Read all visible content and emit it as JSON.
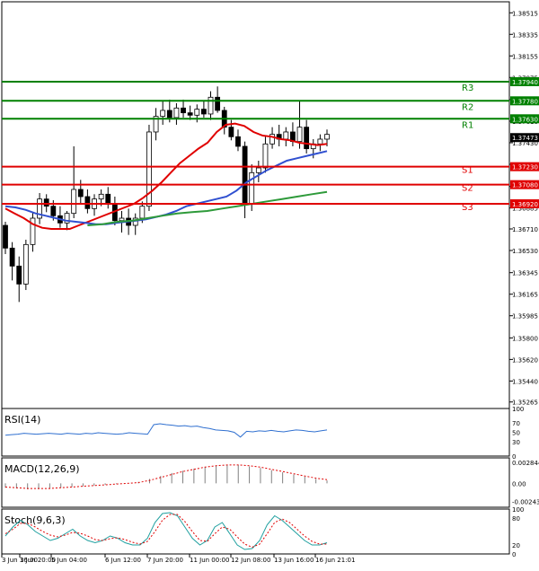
{
  "chart_data": {
    "type": "candlestick",
    "instrument_timeframe": "",
    "x_tick_labels": [
      "3 Jun 16:00",
      "3 Jun 20:00",
      "5 Jun 04:00",
      "6 Jun 12:00",
      "7 Jun 20:00",
      "11 Jun 00:00",
      "12 Jun 08:00",
      "13 Jun 16:00",
      "16 Jun 21:01"
    ],
    "price_axis": {
      "ylim": [
        1.35173,
        1.38607
      ],
      "tick_values": [
        1.38515,
        1.38335,
        1.38155,
        1.37975,
        1.3779,
        1.3761,
        1.3743,
        1.3725,
        1.37065,
        1.36885,
        1.3671,
        1.3653,
        1.36345,
        1.36165,
        1.35985,
        1.358,
        1.3562,
        1.3544,
        1.35265
      ],
      "tick_labels": [
        "1.38515",
        "1.38335",
        "1.38155",
        "1.37975",
        "1.37790",
        "1.37610",
        "1.37430",
        "1.37250",
        "1.37065",
        "1.36885",
        "1.36710",
        "1.36530",
        "1.36345",
        "1.36165",
        "1.35985",
        "1.35800",
        "1.35620",
        "1.35440",
        "1.35265"
      ],
      "current_price": 1.37473,
      "current_price_label": "1.37473"
    },
    "levels": [
      {
        "name": "R3",
        "value": 1.3794,
        "label": "1.37940",
        "kind": "resistance",
        "color": "#008000"
      },
      {
        "name": "R2",
        "value": 1.3778,
        "label": "1.37780",
        "kind": "resistance",
        "color": "#008000"
      },
      {
        "name": "R1",
        "value": 1.3763,
        "label": "1.37630",
        "kind": "resistance",
        "color": "#008000"
      },
      {
        "name": "S1",
        "value": 1.3723,
        "label": "1.37230",
        "kind": "support",
        "color": "#e00000"
      },
      {
        "name": "S2",
        "value": 1.3708,
        "label": "1.37080",
        "kind": "support",
        "color": "#e00000"
      },
      {
        "name": "S3",
        "value": 1.3692,
        "label": "1.36920",
        "kind": "support",
        "color": "#e00000"
      }
    ],
    "candles": [
      [
        1.3674,
        1.3677,
        1.365,
        1.3655
      ],
      [
        1.3655,
        1.366,
        1.3628,
        1.364
      ],
      [
        1.364,
        1.3648,
        1.361,
        1.3625
      ],
      [
        1.3625,
        1.3662,
        1.362,
        1.3658
      ],
      [
        1.3658,
        1.3685,
        1.3652,
        1.368
      ],
      [
        1.368,
        1.3701,
        1.3675,
        1.3696
      ],
      [
        1.3696,
        1.37,
        1.3685,
        1.369
      ],
      [
        1.369,
        1.3695,
        1.3678,
        1.3682
      ],
      [
        1.3682,
        1.369,
        1.3672,
        1.3676
      ],
      [
        1.3676,
        1.3686,
        1.367,
        1.3684
      ],
      [
        1.3684,
        1.374,
        1.368,
        1.3704
      ],
      [
        1.3704,
        1.3712,
        1.3692,
        1.3698
      ],
      [
        1.3698,
        1.3704,
        1.3684,
        1.3688
      ],
      [
        1.3688,
        1.37,
        1.3682,
        1.3696
      ],
      [
        1.3696,
        1.3704,
        1.369,
        1.37
      ],
      [
        1.37,
        1.3706,
        1.3688,
        1.3692
      ],
      [
        1.3692,
        1.3698,
        1.3674,
        1.3678
      ],
      [
        1.3678,
        1.3686,
        1.3668,
        1.368
      ],
      [
        1.368,
        1.3688,
        1.3666,
        1.3674
      ],
      [
        1.3674,
        1.3684,
        1.3666,
        1.368
      ],
      [
        1.368,
        1.3694,
        1.3676,
        1.369
      ],
      [
        1.369,
        1.3758,
        1.3686,
        1.3752
      ],
      [
        1.3752,
        1.3772,
        1.3745,
        1.3765
      ],
      [
        1.3765,
        1.3778,
        1.3758,
        1.377
      ],
      [
        1.377,
        1.3779,
        1.376,
        1.3764
      ],
      [
        1.3764,
        1.3776,
        1.3758,
        1.3772
      ],
      [
        1.3772,
        1.3779,
        1.3764,
        1.3768
      ],
      [
        1.3768,
        1.3774,
        1.3762,
        1.3766
      ],
      [
        1.3766,
        1.3775,
        1.376,
        1.3771
      ],
      [
        1.3771,
        1.3778,
        1.3764,
        1.3767
      ],
      [
        1.3767,
        1.3786,
        1.3762,
        1.3781
      ],
      [
        1.3781,
        1.379,
        1.3768,
        1.377
      ],
      [
        1.377,
        1.3773,
        1.375,
        1.3756
      ],
      [
        1.3756,
        1.3762,
        1.3745,
        1.3748
      ],
      [
        1.3748,
        1.3754,
        1.3736,
        1.374
      ],
      [
        1.374,
        1.3744,
        1.368,
        1.3692
      ],
      [
        1.3692,
        1.3725,
        1.3686,
        1.3718
      ],
      [
        1.3718,
        1.3728,
        1.371,
        1.3722
      ],
      [
        1.3722,
        1.3748,
        1.3718,
        1.3742
      ],
      [
        1.3742,
        1.3756,
        1.3738,
        1.375
      ],
      [
        1.375,
        1.3758,
        1.374,
        1.3746
      ],
      [
        1.3746,
        1.3756,
        1.374,
        1.3752
      ],
      [
        1.3752,
        1.376,
        1.374,
        1.3744
      ],
      [
        1.3744,
        1.3778,
        1.3738,
        1.3756
      ],
      [
        1.3756,
        1.3762,
        1.3734,
        1.3738
      ],
      [
        1.3738,
        1.3746,
        1.373,
        1.3742
      ],
      [
        1.3742,
        1.375,
        1.3736,
        1.3746
      ],
      [
        1.3746,
        1.3754,
        1.374,
        1.375
      ]
    ],
    "series": [
      {
        "style": "line",
        "color": "#e00000",
        "values": [
          1.3688,
          1.3684,
          1.368,
          1.3675,
          1.3672,
          1.3671,
          1.3671,
          1.3671,
          1.3674,
          1.3677,
          1.368,
          1.3683,
          1.3686,
          1.3689,
          1.3692,
          1.3697,
          1.3703,
          1.371,
          1.3718,
          1.3726,
          1.3732,
          1.3738,
          1.3743,
          1.3752,
          1.3758,
          1.3759,
          1.3757,
          1.3752,
          1.3749,
          1.3748,
          1.3746,
          1.3745,
          1.3743,
          1.3742,
          1.3741,
          1.3742
        ]
      },
      {
        "style": "line",
        "color": "#3050d0",
        "values": [
          1.369,
          1.3689,
          1.3687,
          1.3684,
          1.3682,
          1.368,
          1.3678,
          1.3677,
          1.3676,
          1.3675,
          1.3675,
          1.3676,
          1.3677,
          1.3678,
          1.3679,
          1.3681,
          1.3683,
          1.3686,
          1.369,
          1.3692,
          1.3694,
          1.3696,
          1.3698,
          1.3703,
          1.371,
          1.3715,
          1.372,
          1.3724,
          1.3728,
          1.373,
          1.3732,
          1.3734,
          1.3736
        ]
      },
      {
        "style": "line",
        "color": "#2e9a3a",
        "values": [
          1.3674,
          1.3675,
          1.3677,
          1.3678,
          1.368,
          1.3682,
          1.3684,
          1.3685,
          1.3686,
          1.3688,
          1.369,
          1.3692,
          1.3694,
          1.3696,
          1.3698,
          1.37,
          1.3702
        ]
      }
    ],
    "panels": [
      {
        "name": "RSI(14)",
        "ylim": [
          0,
          100
        ],
        "tick_labels": [
          "100",
          "70",
          "50",
          "30",
          "0"
        ],
        "tick_values": [
          100,
          70,
          50,
          30,
          0
        ],
        "series_color": "#3070d0",
        "values": [
          44,
          45,
          46,
          48,
          47,
          46,
          47,
          48,
          47,
          46,
          48,
          47,
          46,
          48,
          47,
          49,
          48,
          47,
          46,
          47,
          49,
          48,
          47,
          46,
          66,
          68,
          66,
          65,
          63,
          64,
          62,
          63,
          60,
          58,
          55,
          54,
          53,
          50,
          40,
          52,
          51,
          53,
          52,
          54,
          52,
          51,
          53,
          55,
          54,
          52,
          51,
          53,
          55
        ]
      },
      {
        "name": "MACD(12,26,9)",
        "ylim": [
          -0.00325,
          0.00346
        ],
        "tick_labels": [
          "0.002844",
          "0.00",
          "-0.002432"
        ],
        "tick_values": [
          0.002844,
          0,
          -0.002432
        ],
        "histogram": [
          -0.0006,
          -0.0007,
          -0.0008,
          -0.0008,
          -0.0007,
          -0.0006,
          -0.0005,
          -0.0004,
          -0.0003,
          -0.0002,
          -0.0001,
          0.0,
          0.0002,
          0.0006,
          0.001,
          0.0014,
          0.0017,
          0.002,
          0.0022,
          0.0024,
          0.0025,
          0.0025,
          0.0023,
          0.0021,
          0.0018,
          0.0015,
          0.0012,
          0.0009,
          0.0006,
          0.0004
        ],
        "signal": [
          -0.0005,
          -0.0006,
          -0.0007,
          -0.0007,
          -0.0007,
          -0.0006,
          -0.0005,
          -0.0004,
          -0.0003,
          -0.0002,
          -0.0001,
          0.0,
          0.0001,
          0.0004,
          0.0008,
          0.0012,
          0.0016,
          0.0019,
          0.0022,
          0.0024,
          0.0025,
          0.0025,
          0.0024,
          0.0022,
          0.0019,
          0.0016,
          0.0013,
          0.001,
          0.0007,
          0.0005
        ]
      },
      {
        "name": "Stoch(9,6,3)",
        "ylim": [
          0,
          100
        ],
        "tick_labels": [
          "100",
          "80",
          "20",
          "0"
        ],
        "tick_values": [
          100,
          80,
          20,
          0
        ],
        "main": [
          40,
          60,
          75,
          65,
          50,
          40,
          30,
          35,
          45,
          55,
          40,
          30,
          25,
          30,
          40,
          35,
          25,
          20,
          20,
          35,
          70,
          90,
          92,
          85,
          60,
          35,
          20,
          30,
          60,
          70,
          45,
          20,
          10,
          12,
          30,
          65,
          85,
          75,
          60,
          45,
          30,
          20,
          20,
          25
        ],
        "signal": [
          45,
          55,
          68,
          68,
          60,
          50,
          42,
          38,
          42,
          48,
          46,
          40,
          32,
          30,
          34,
          36,
          32,
          26,
          22,
          28,
          50,
          75,
          88,
          88,
          72,
          50,
          30,
          28,
          45,
          60,
          55,
          38,
          22,
          15,
          22,
          45,
          70,
          78,
          70,
          55,
          40,
          28,
          22,
          22
        ]
      }
    ]
  }
}
